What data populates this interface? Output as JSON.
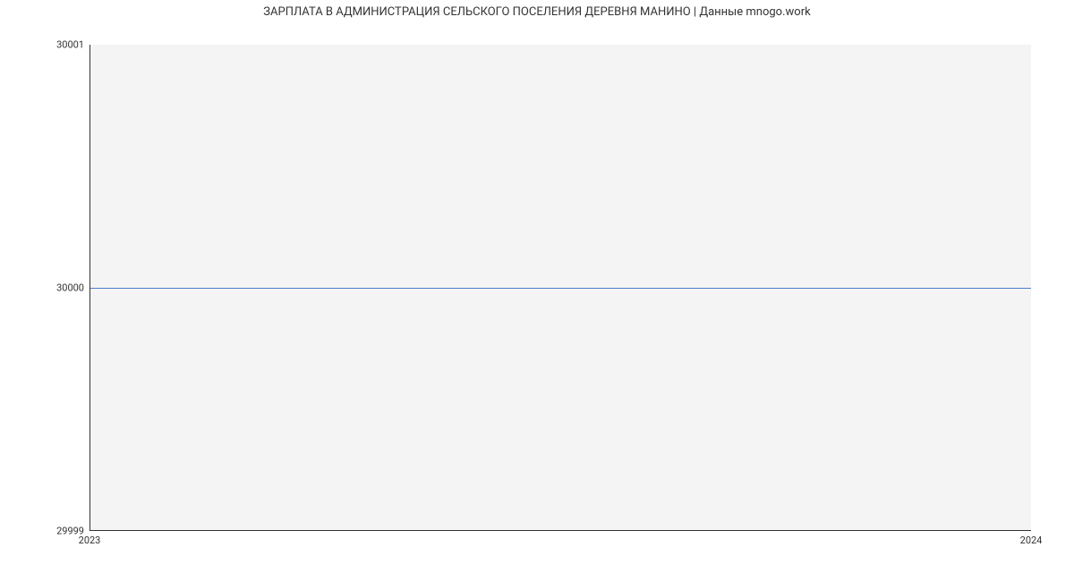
{
  "chart_data": {
    "type": "line",
    "title": "ЗАРПЛАТА В АДМИНИСТРАЦИЯ СЕЛЬСКОГО ПОСЕЛЕНИЯ ДЕРЕВНЯ МАНИНО | Данные mnogo.work",
    "x": [
      2023,
      2024
    ],
    "values": [
      30000,
      30000
    ],
    "xlabel": "",
    "ylabel": "",
    "ylim": [
      29999,
      30001
    ],
    "xlim": [
      2023,
      2024
    ],
    "y_ticks": [
      29999,
      30000,
      30001
    ],
    "x_ticks": [
      2023,
      2024
    ],
    "line_color": "#4a7ecc",
    "plot_bg": "#f4f4f4"
  }
}
